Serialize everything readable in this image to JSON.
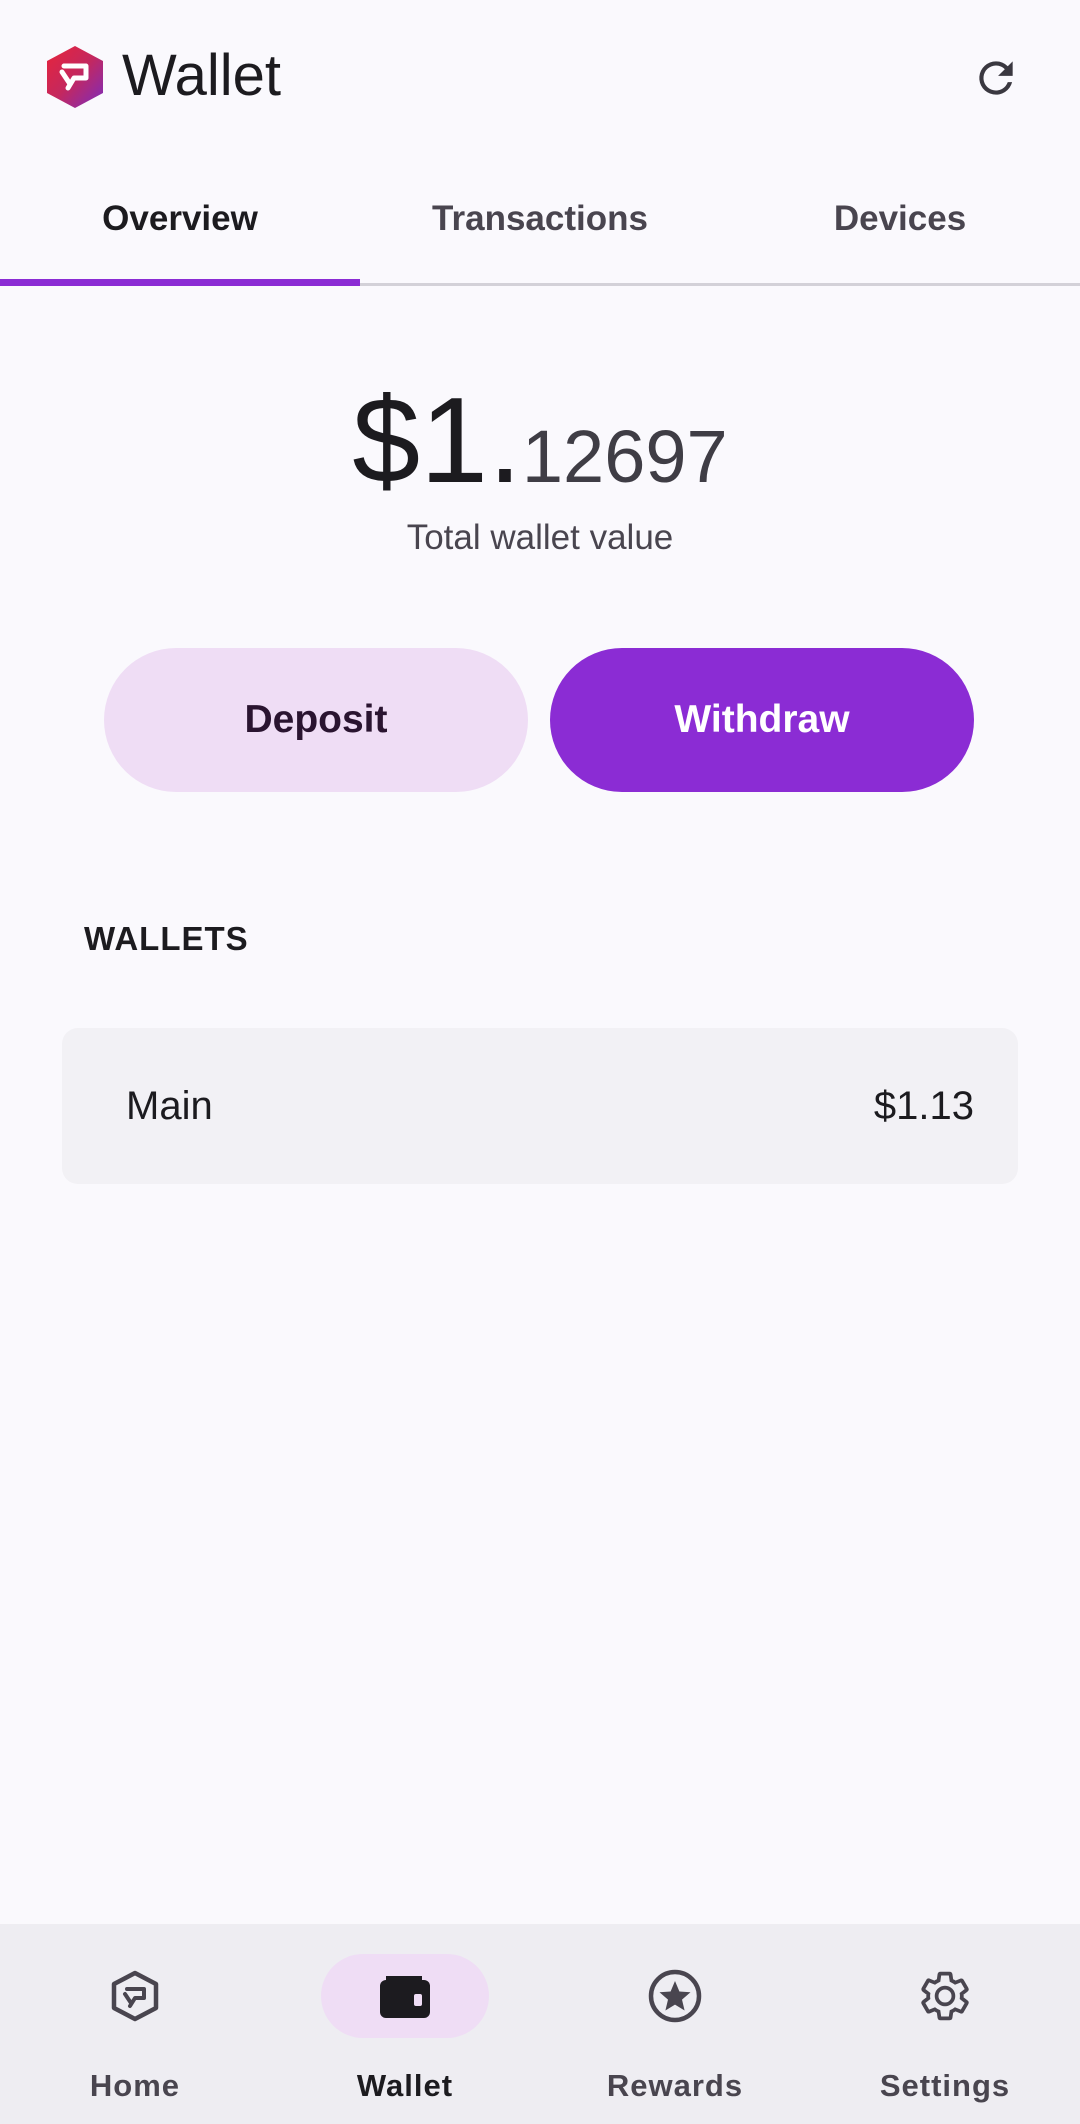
{
  "header": {
    "title": "Wallet",
    "logo_icon": "shield-logo-icon",
    "refresh_icon": "refresh-icon"
  },
  "tabs": [
    {
      "label": "Overview",
      "active": true
    },
    {
      "label": "Transactions",
      "active": false
    },
    {
      "label": "Devices",
      "active": false
    }
  ],
  "balance": {
    "integer_part": "$1.",
    "decimal_part": "12697",
    "label": "Total wallet value"
  },
  "actions": {
    "deposit_label": "Deposit",
    "withdraw_label": "Withdraw"
  },
  "wallets": {
    "section_title": "WALLETS",
    "items": [
      {
        "name": "Main",
        "value": "$1.13"
      }
    ]
  },
  "bottom_nav": [
    {
      "label": "Home",
      "icon": "home-shield-icon",
      "active": false
    },
    {
      "label": "Wallet",
      "icon": "wallet-icon",
      "active": true
    },
    {
      "label": "Rewards",
      "icon": "star-icon",
      "active": false
    },
    {
      "label": "Settings",
      "icon": "gear-icon",
      "active": false
    }
  ],
  "colors": {
    "accent": "#8B2CD4",
    "accent_container": "#EFDDF5",
    "background": "#FAF9FD",
    "card": "#F2F1F5",
    "nav_background": "#EEEDF2"
  }
}
